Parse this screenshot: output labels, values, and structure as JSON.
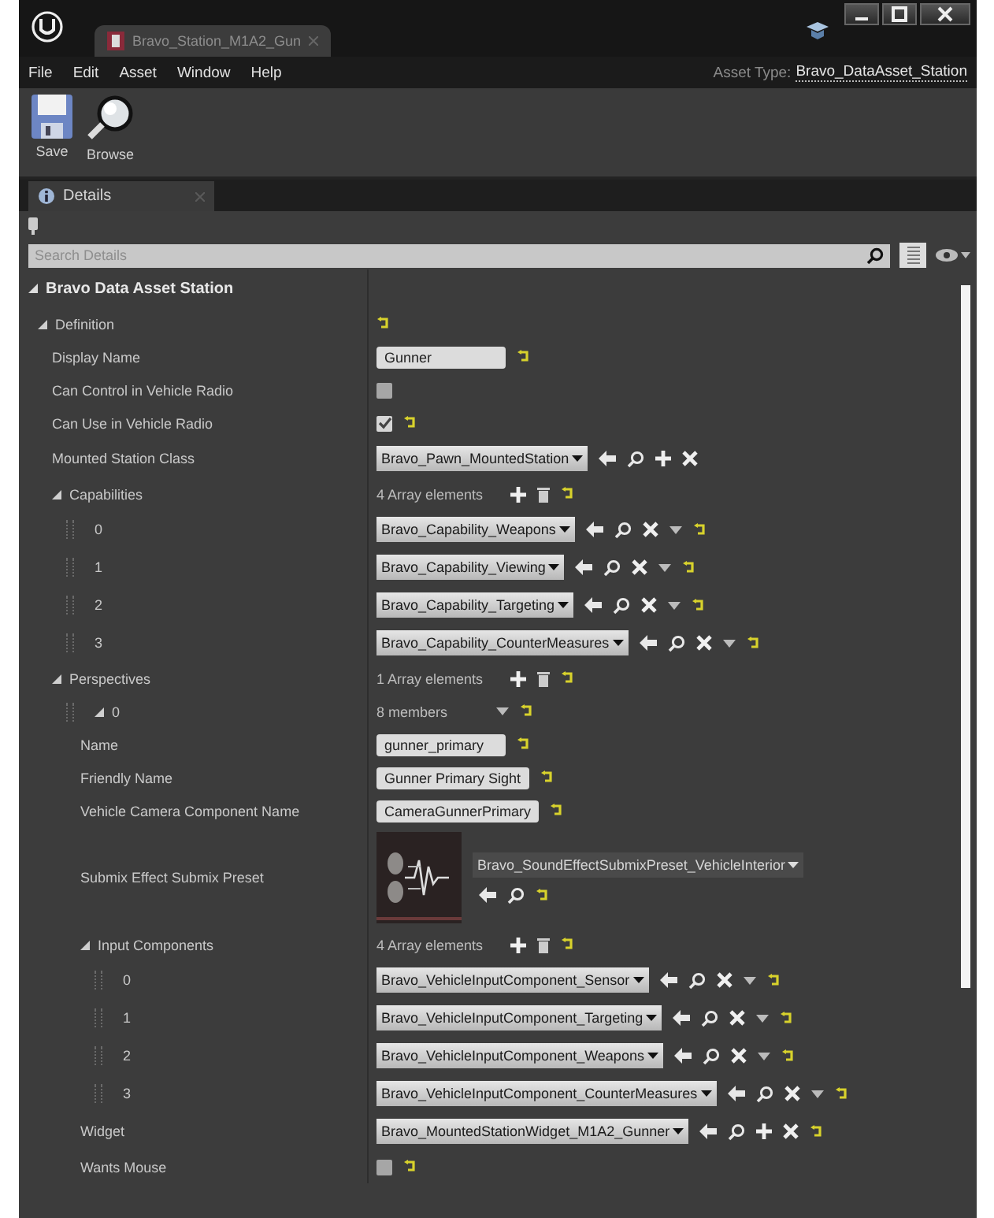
{
  "window": {
    "tab_title": "Bravo_Station_M1A2_Gun",
    "asset_type_label": "Asset Type:",
    "asset_type": "Bravo_DataAsset_Station"
  },
  "menu": [
    "File",
    "Edit",
    "Asset",
    "Window",
    "Help"
  ],
  "toolbar": [
    {
      "label": "Save",
      "kind": "save"
    },
    {
      "label": "Browse",
      "kind": "browse"
    }
  ],
  "panel": {
    "tab": "Details",
    "search": {
      "placeholder": "Search Details"
    }
  },
  "category": {
    "title": "Bravo Data Asset Station",
    "expanded": true
  },
  "properties": [
    {
      "name": "Definition",
      "kind": "group",
      "expanded": true,
      "reset": true,
      "children": [
        {
          "name": "Display Name",
          "kind": "text",
          "value": "Gunner",
          "reset": true
        },
        {
          "name": "Can Control in Vehicle Radio",
          "kind": "checkbox",
          "checked": false,
          "reset": false
        },
        {
          "name": "Can Use in Vehicle Radio",
          "kind": "checkbox",
          "checked": true,
          "reset": true
        },
        {
          "name": "Mounted Station Class",
          "kind": "object",
          "value": "Bravo_Pawn_MountedStation",
          "actions": [
            {
              "kind": "use"
            },
            {
              "kind": "browse"
            },
            {
              "kind": "add"
            },
            {
              "kind": "clear"
            }
          ],
          "reset": false
        },
        {
          "name": "Capabilities",
          "kind": "array",
          "value": "4 Array elements",
          "expanded": true,
          "reset": true,
          "children": [
            {
              "name": "0",
              "kind": "object",
              "handle": true,
              "value": "Bravo_Capability_Weapons",
              "actions": [
                {
                  "kind": "use"
                },
                {
                  "kind": "browse"
                },
                {
                  "kind": "clear"
                },
                {
                  "kind": "menu"
                }
              ],
              "reset": true
            },
            {
              "name": "1",
              "kind": "object",
              "handle": true,
              "value": "Bravo_Capability_Viewing",
              "actions": [
                {
                  "kind": "use"
                },
                {
                  "kind": "browse"
                },
                {
                  "kind": "clear"
                },
                {
                  "kind": "menu"
                }
              ],
              "reset": true
            },
            {
              "name": "2",
              "kind": "object",
              "handle": true,
              "value": "Bravo_Capability_Targeting",
              "actions": [
                {
                  "kind": "use"
                },
                {
                  "kind": "browse"
                },
                {
                  "kind": "clear"
                },
                {
                  "kind": "menu"
                }
              ],
              "reset": true
            },
            {
              "name": "3",
              "kind": "object",
              "handle": true,
              "value": "Bravo_Capability_CounterMeasures",
              "actions": [
                {
                  "kind": "use"
                },
                {
                  "kind": "browse"
                },
                {
                  "kind": "clear"
                },
                {
                  "kind": "menu"
                }
              ],
              "reset": true
            }
          ]
        },
        {
          "name": "Perspectives",
          "kind": "array",
          "value": "1 Array elements",
          "expanded": true,
          "reset": true,
          "children": [
            {
              "name": "0",
              "kind": "struct",
              "handle": true,
              "value": "8 members",
              "expanded": true,
              "reset": true,
              "children": [
                {
                  "name": "Name",
                  "kind": "text",
                  "value": "gunner_primary",
                  "reset": true
                },
                {
                  "name": "Friendly Name",
                  "kind": "text",
                  "value": "Gunner Primary Sight",
                  "reset": true
                },
                {
                  "name": "Vehicle Camera Component Name",
                  "kind": "text",
                  "value": "CameraGunnerPrimary",
                  "reset": true
                },
                {
                  "name": "Submix Effect Submix Preset",
                  "kind": "asset",
                  "value": "Bravo_SoundEffectSubmixPreset_VehicleInterior",
                  "actions": [
                    {
                      "kind": "use"
                    },
                    {
                      "kind": "browse"
                    }
                  ],
                  "reset": true
                },
                {
                  "name": "Input Components",
                  "kind": "array",
                  "value": "4 Array elements",
                  "expanded": true,
                  "reset": true,
                  "children": [
                    {
                      "name": "0",
                      "kind": "object",
                      "handle": true,
                      "value": "Bravo_VehicleInputComponent_Sensor",
                      "actions": [
                        {
                          "kind": "use"
                        },
                        {
                          "kind": "browse"
                        },
                        {
                          "kind": "clear"
                        },
                        {
                          "kind": "menu"
                        }
                      ],
                      "reset": true
                    },
                    {
                      "name": "1",
                      "kind": "object",
                      "handle": true,
                      "value": "Bravo_VehicleInputComponent_Targeting",
                      "actions": [
                        {
                          "kind": "use"
                        },
                        {
                          "kind": "browse"
                        },
                        {
                          "kind": "clear"
                        },
                        {
                          "kind": "menu"
                        }
                      ],
                      "reset": true
                    },
                    {
                      "name": "2",
                      "kind": "object",
                      "handle": true,
                      "value": "Bravo_VehicleInputComponent_Weapons",
                      "actions": [
                        {
                          "kind": "use"
                        },
                        {
                          "kind": "browse"
                        },
                        {
                          "kind": "clear"
                        },
                        {
                          "kind": "menu"
                        }
                      ],
                      "reset": true
                    },
                    {
                      "name": "3",
                      "kind": "object",
                      "handle": true,
                      "value": "Bravo_VehicleInputComponent_CounterMeasures",
                      "actions": [
                        {
                          "kind": "use"
                        },
                        {
                          "kind": "browse"
                        },
                        {
                          "kind": "clear"
                        },
                        {
                          "kind": "menu"
                        }
                      ],
                      "reset": true
                    }
                  ]
                },
                {
                  "name": "Widget",
                  "kind": "object",
                  "value": "Bravo_MountedStationWidget_M1A2_Gunner",
                  "actions": [
                    {
                      "kind": "use"
                    },
                    {
                      "kind": "browse"
                    },
                    {
                      "kind": "add"
                    },
                    {
                      "kind": "clear"
                    }
                  ],
                  "reset": true
                },
                {
                  "name": "Wants Mouse",
                  "kind": "checkbox",
                  "checked": false,
                  "reset": true
                }
              ]
            }
          ]
        }
      ]
    }
  ]
}
